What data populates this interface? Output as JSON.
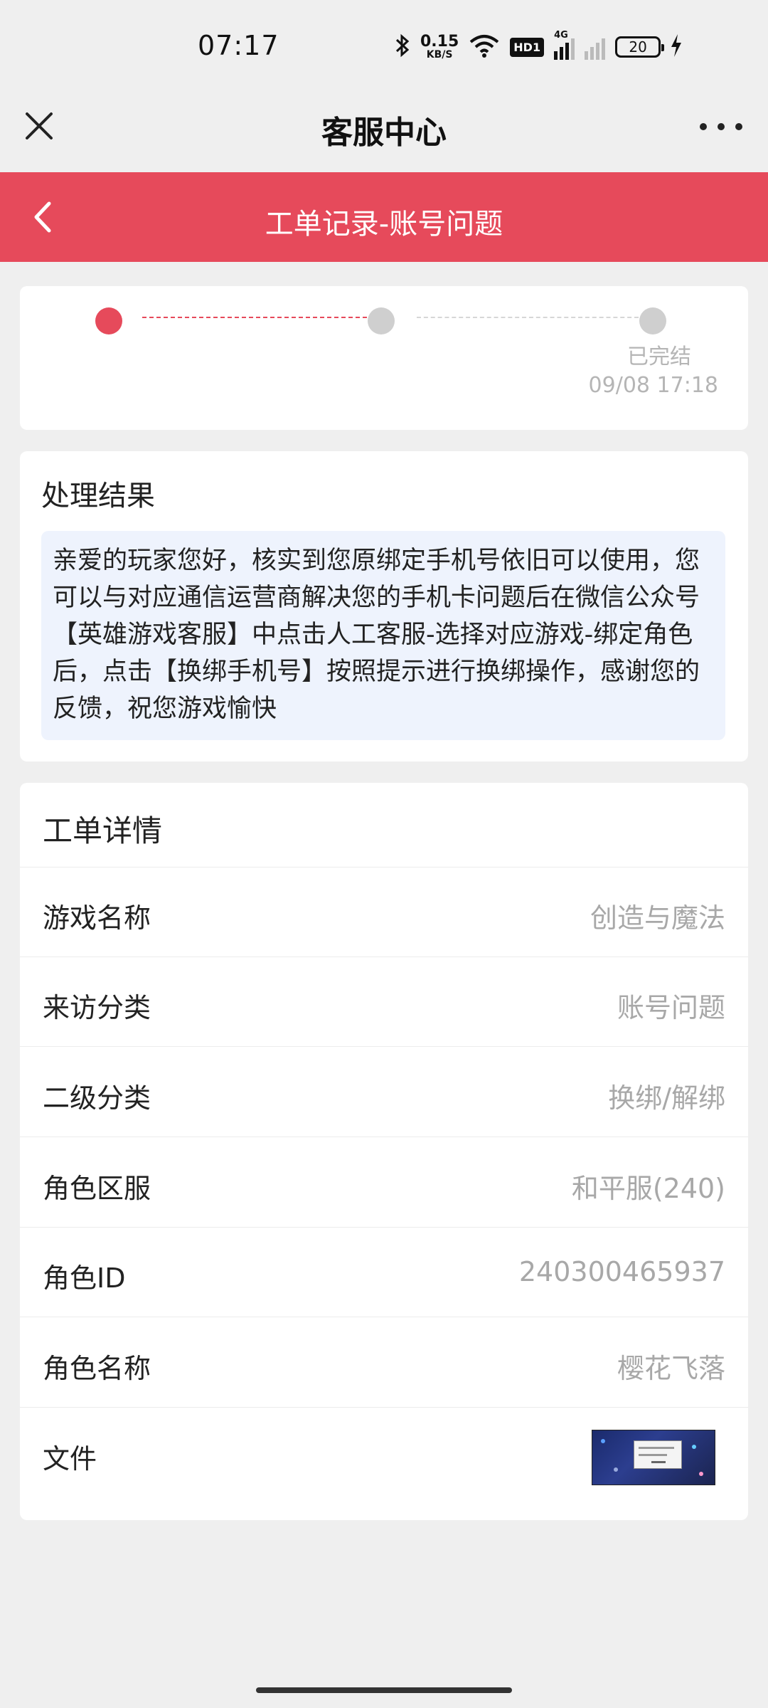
{
  "status_bar": {
    "time": "07:17",
    "net_speed_value": "0.15",
    "net_speed_unit": "KB/S",
    "hd_badge": "HD1",
    "network_type": "4G",
    "battery": "20"
  },
  "title_bar": {
    "title": "客服中心"
  },
  "header": {
    "title": "工单记录-账号问题"
  },
  "progress": {
    "steps_total": 3,
    "current_step": 1,
    "final_label": "已完结",
    "final_time": "09/08 17:18"
  },
  "result": {
    "title": "处理结果",
    "text": "亲爱的玩家您好，核实到您原绑定手机号依旧可以使用，您可以与对应通信运营商解决您的手机卡问题后在微信公众号【英雄游戏客服】中点击人工客服-选择对应游戏-绑定角色后，点击【换绑手机号】按照提示进行换绑操作，感谢您的反馈，祝您游戏愉快"
  },
  "details": {
    "title": "工单详情",
    "rows": [
      {
        "label": "游戏名称",
        "value": "创造与魔法"
      },
      {
        "label": "来访分类",
        "value": "账号问题"
      },
      {
        "label": "二级分类",
        "value": "换绑/解绑"
      },
      {
        "label": "角色区服",
        "value": "和平服(240)"
      },
      {
        "label": "角色ID",
        "value": "240300465937"
      },
      {
        "label": "角色名称",
        "value": "樱花飞落"
      }
    ],
    "file_label": "文件"
  },
  "colors": {
    "accent": "#e64a5b",
    "background": "#efefef",
    "result_box": "#eef3fd"
  }
}
